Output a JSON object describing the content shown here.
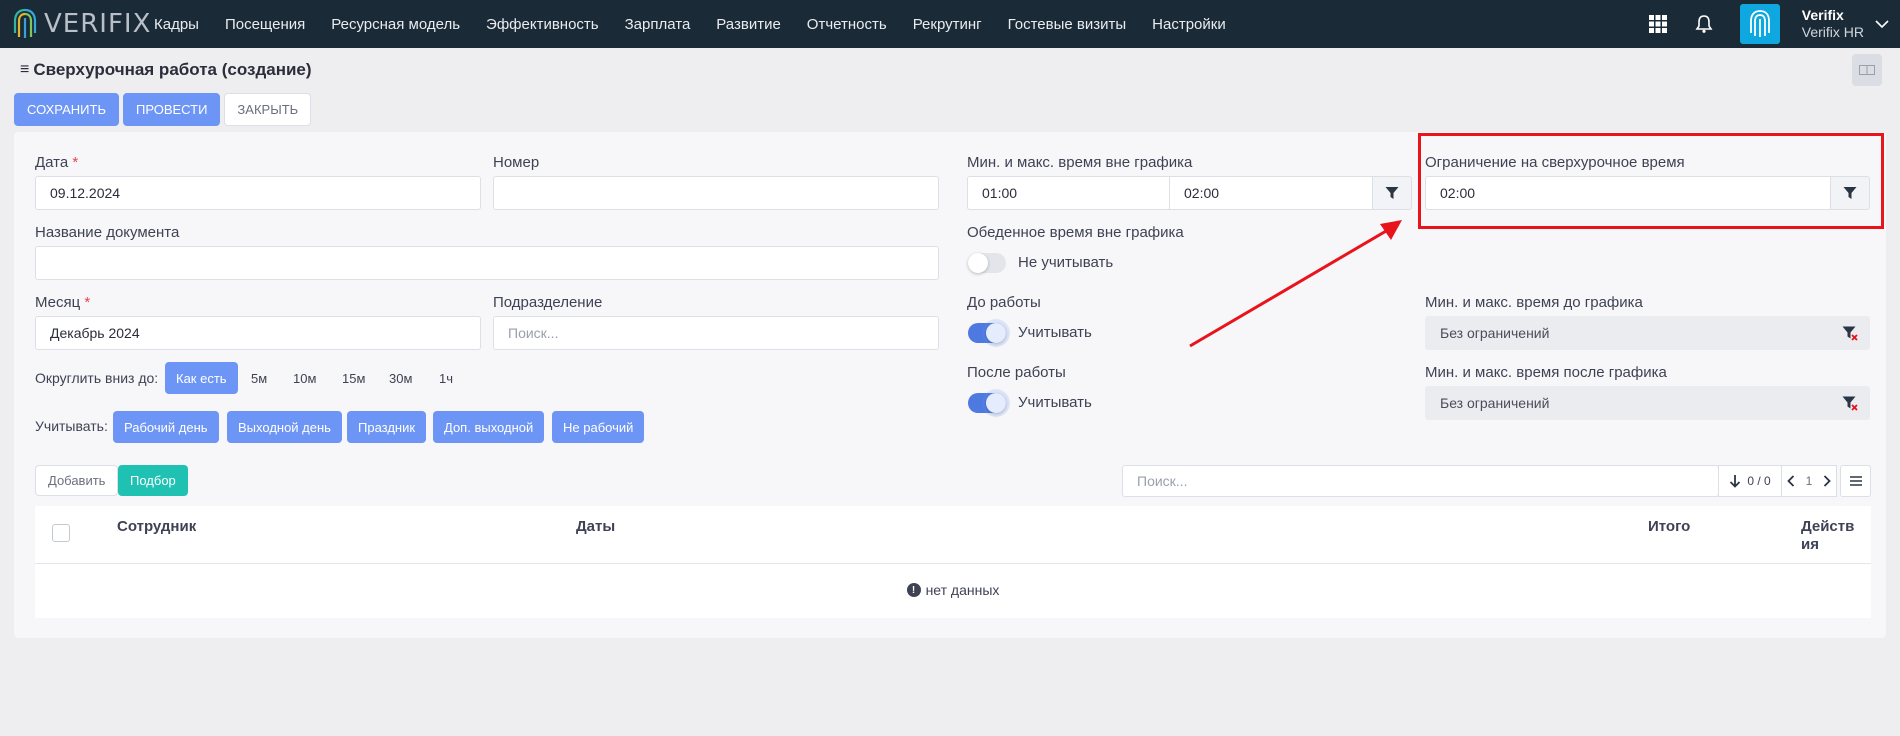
{
  "nav": {
    "logo": "VERIFIX",
    "items": [
      "Кадры",
      "Посещения",
      "Ресурсная модель",
      "Эффективность",
      "Зарплата",
      "Развитие",
      "Отчетность",
      "Рекрутинг",
      "Гостевые визиты",
      "Настройки"
    ],
    "user_name": "Verifix",
    "user_company": "Verifix HR"
  },
  "header": {
    "title": "Сверхурочная работа (создание)",
    "save": "СОХРАНИТЬ",
    "post": "ПРОВЕСТИ",
    "close": "ЗАКРЫТЬ"
  },
  "form": {
    "date_label": "Дата",
    "date_value": "09.12.2024",
    "number_label": "Номер",
    "number_value": "",
    "docname_label": "Название документа",
    "docname_value": "",
    "month_label": "Месяц",
    "month_value": "Декабрь 2024",
    "division_label": "Подразделение",
    "division_placeholder": "Поиск...",
    "required_mark": "*",
    "round_label": "Округлить вниз до:",
    "round_options": [
      "Как есть",
      "5м",
      "10м",
      "15м",
      "30м",
      "1ч"
    ],
    "count_label": "Учитывать:",
    "count_options": [
      "Рабочий день",
      "Выходной день",
      "Праздник",
      "Доп. выходной",
      "Не рабочий"
    ],
    "offsched_label": "Мин. и макс. время вне графика",
    "offsched_min": "01:00",
    "offsched_max": "02:00",
    "lunch_label": "Обеденное время вне графика",
    "lunch_toggle": "Не учитывать",
    "before_label": "До работы",
    "before_toggle": "Учитывать",
    "after_label": "После работы",
    "after_toggle": "Учитывать",
    "limit_label": "Ограничение на сверхурочное время",
    "limit_value": "02:00",
    "before_range_label": "Мин. и макс. время до графика",
    "before_range_value": "Без ограничений",
    "after_range_label": "Мин. и макс. время после графика",
    "after_range_value": "Без ограничений"
  },
  "table": {
    "add": "Добавить",
    "pick": "Подбор",
    "search_placeholder": "Поиск...",
    "count": "0 / 0",
    "page": "1",
    "col_employee": "Сотрудник",
    "col_dates": "Даты",
    "col_total": "Итого",
    "col_actions": "Действия",
    "no_data": "нет данных"
  },
  "colors": {
    "primary": "#6d95f5",
    "teal": "#1fc2b2",
    "nav_bg": "#1b2a37",
    "highlight": "#e8141b"
  }
}
